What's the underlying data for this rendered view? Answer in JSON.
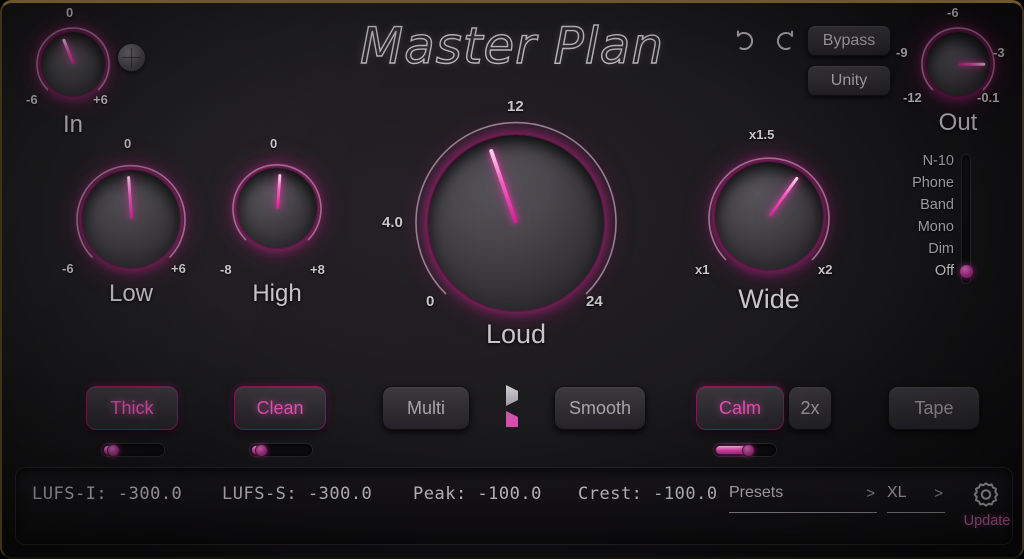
{
  "app": {
    "title": "Master Plan"
  },
  "header": {
    "undo_icon": "undo-arrow-icon",
    "redo_icon": "redo-arrow-icon",
    "bypass_label": "Bypass",
    "unity_label": "Unity",
    "screw_icon": "metal-screw-icon"
  },
  "knobs": {
    "in": {
      "label": "In",
      "top_tick": "0",
      "left_tick": "-6",
      "right_tick": "+6",
      "value_angle": -22
    },
    "out": {
      "label": "Out",
      "top_tick": "-6",
      "left_tick": "-9",
      "right_tick": "-3",
      "bottom_left_tick": "-12",
      "bottom_right_tick": "-0.1",
      "value_angle": 90
    },
    "low": {
      "label": "Low",
      "top_tick": "0",
      "left_tick": "-6",
      "right_tick": "+6",
      "value_angle": -4
    },
    "high": {
      "label": "High",
      "top_tick": "0",
      "left_tick": "-8",
      "right_tick": "+8",
      "value_angle": 4
    },
    "loud": {
      "label": "Loud",
      "top_tick": "12",
      "left_tick": "4.0",
      "bottom_left_tick": "0",
      "bottom_right_tick": "24",
      "value_angle": -19
    },
    "wide": {
      "label": "Wide",
      "top_tick": "x1.5",
      "bottom_left_tick": "x1",
      "bottom_right_tick": "x2",
      "value_angle": 36
    }
  },
  "monitor": {
    "items": [
      {
        "label": "N-10",
        "selected": false
      },
      {
        "label": "Phone",
        "selected": false
      },
      {
        "label": "Band",
        "selected": false
      },
      {
        "label": "Mono",
        "selected": false
      },
      {
        "label": "Dim",
        "selected": false
      },
      {
        "label": "Off",
        "selected": true
      }
    ]
  },
  "modes": {
    "thick": {
      "label": "Thick",
      "active": true,
      "slider_percent": 18
    },
    "clean": {
      "label": "Clean",
      "active": true,
      "slider_percent": 18
    },
    "multi": {
      "label": "Multi",
      "active": false
    },
    "bolt_icon": "lightning-bolt-icon",
    "smooth": {
      "label": "Smooth",
      "active": false
    },
    "calm": {
      "label": "Calm",
      "active": true,
      "slider_percent": 56
    },
    "twox": {
      "label": "2x",
      "active": false
    },
    "tape": {
      "label": "Tape",
      "active": false
    }
  },
  "status": {
    "lufs_i": "LUFS-I: -300.0",
    "lufs_s": "LUFS-S: -300.0",
    "peak": "Peak: -100.0",
    "crest": "Crest: -100.0",
    "presets_label": "Presets",
    "presets_caret": ">",
    "size_label": "XL",
    "size_caret": ">",
    "gear_icon": "gear-icon",
    "update_label": "Update"
  },
  "colors": {
    "accent": "#e845b4",
    "accent_bright": "#f254bd",
    "panel": "#1b1a1d",
    "border_gold": "#6b5a28",
    "text": "#c8c5ca"
  }
}
